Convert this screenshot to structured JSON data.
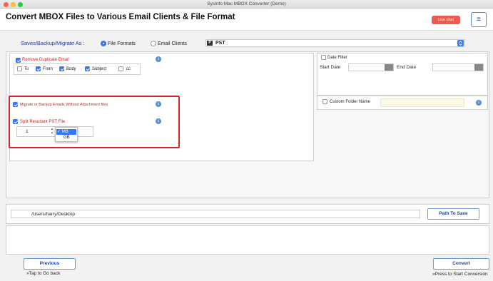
{
  "window": {
    "title": "SysInfo Mac MBOX Converter (Demo)"
  },
  "header": {
    "app_title": "Convert MBOX Files to Various Email Clients & File Format",
    "live_chat_label": "Live chat",
    "menu_glyph": "≡"
  },
  "save_as": {
    "label": "Saves/Backup/Migrate As :",
    "options": [
      {
        "label": "File Formats",
        "selected": true
      },
      {
        "label": "Email Clients",
        "selected": false
      }
    ],
    "format_icon_glyph": "P",
    "format_value": "PST"
  },
  "options": {
    "remove_duplicate": {
      "label": "Remove Duplicate Email",
      "checked": true
    },
    "fields": [
      {
        "label": "To",
        "checked": false
      },
      {
        "label": "From",
        "checked": true
      },
      {
        "label": "Body",
        "checked": true
      },
      {
        "label": "Subject",
        "checked": true
      },
      {
        "label": "cc",
        "checked": false
      }
    ],
    "migrate_without_attachment": {
      "label": "Migrate or Backup Emails Without Attachment files",
      "checked": true
    },
    "split_pst": {
      "label": "Split Resultant PST File.",
      "checked": true,
      "size_value": "1",
      "units": [
        "MB",
        "GB"
      ],
      "selected_unit": "MB"
    }
  },
  "filters": {
    "date_filter": {
      "label": "Date Filter",
      "checked": false
    },
    "start_date_label": "Start Date",
    "end_date_label": "End Date",
    "custom_folder": {
      "label": "Custom Folder Name",
      "checked": false,
      "value": ""
    }
  },
  "destination": {
    "path": "/Users/harry/Desktop",
    "path_to_save_label": "Path To Save"
  },
  "footer": {
    "previous_label": "Previous",
    "previous_hint": "»Tap to Go back",
    "convert_label": "Convert",
    "convert_hint": "»Press to Start Conversion"
  },
  "colors": {
    "accent": "#3478f6",
    "title_blue": "#1d36a3",
    "highlight_red": "#d6262b",
    "live_chat": "#ee5a52"
  }
}
